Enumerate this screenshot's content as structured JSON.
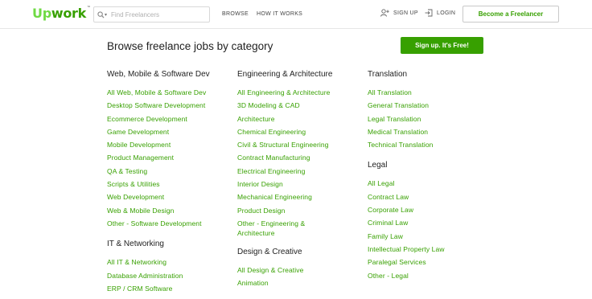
{
  "brand": {
    "logo_up": "Up",
    "logo_work": "work",
    "tm": "™"
  },
  "search": {
    "placeholder": "Find Freelancers"
  },
  "nav": {
    "browse": "BROWSE",
    "how_it_works": "HOW IT WORKS",
    "sign_up": "SIGN UP",
    "login": "LOGIN"
  },
  "header": {
    "become_freelancer": "Become a Freelancer"
  },
  "main": {
    "title": "Browse freelance jobs by category",
    "signup_button": "Sign up. It's Free!"
  },
  "columns": [
    {
      "groups": [
        {
          "heading": "Web, Mobile & Software Dev",
          "links": [
            "All Web, Mobile & Software Dev",
            "Desktop Software Development",
            "Ecommerce Development",
            "Game Development",
            "Mobile Development",
            "Product Management",
            "QA & Testing",
            "Scripts & Utilities",
            "Web Development",
            "Web & Mobile Design",
            "Other - Software Development"
          ]
        },
        {
          "heading": "IT & Networking",
          "links": [
            "All IT & Networking",
            "Database Administration",
            "ERP / CRM Software"
          ]
        }
      ]
    },
    {
      "groups": [
        {
          "heading": "Engineering & Architecture",
          "links": [
            "All Engineering & Architecture",
            "3D Modeling & CAD",
            "Architecture",
            "Chemical Engineering",
            "Civil & Structural Engineering",
            "Contract Manufacturing",
            "Electrical Engineering",
            "Interior Design",
            "Mechanical Engineering",
            "Product Design",
            "Other - Engineering & Architecture"
          ]
        },
        {
          "heading": "Design & Creative",
          "links": [
            "All Design & Creative",
            "Animation"
          ]
        }
      ]
    },
    {
      "groups": [
        {
          "heading": "Translation",
          "links": [
            "All Translation",
            "General Translation",
            "Legal Translation",
            "Medical Translation",
            "Technical Translation"
          ]
        },
        {
          "heading": "Legal",
          "links": [
            "All Legal",
            "Contract Law",
            "Corporate Law",
            "Criminal Law",
            "Family Law",
            "Intellectual Property Law",
            "Paralegal Services",
            "Other - Legal"
          ]
        }
      ]
    }
  ],
  "icons": {
    "search": "search-icon",
    "sign_up": "user-plus-icon",
    "login": "login-icon"
  },
  "colors": {
    "brand_green": "#37a000",
    "logo_light_green": "#6fda44"
  }
}
